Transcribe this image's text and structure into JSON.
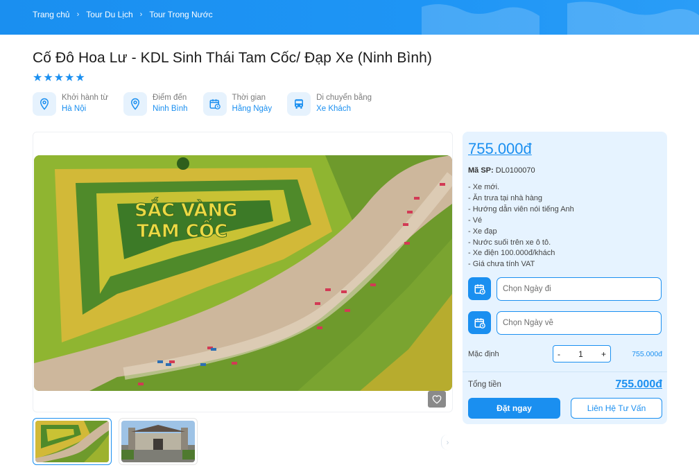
{
  "breadcrumb": {
    "items": [
      "Trang chủ",
      "Tour Du Lịch",
      "Tour Trong Nước"
    ]
  },
  "tour": {
    "title": "Cố Đô Hoa Lư - KDL Sinh Thái Tam Cốc/ Đạp Xe (Ninh Bình)",
    "rating_stars": 5
  },
  "info": [
    {
      "label": "Khởi hành từ",
      "value": "Hà Nội",
      "icon": "map-pin-icon"
    },
    {
      "label": "Điểm đến",
      "value": "Ninh Bình",
      "icon": "map-pin-icon"
    },
    {
      "label": "Thời gian",
      "value": "Hằng Ngày",
      "icon": "calendar-clock-icon"
    },
    {
      "label": "Di chuyển bằng",
      "value": "Xe Khách",
      "icon": "bus-icon"
    }
  ],
  "gallery": {
    "photo_text_line1": "SẮC VÀNG",
    "photo_text_line2": "TAM CỐC"
  },
  "booking": {
    "price": "755.000đ",
    "sku_label": "Mã SP:",
    "sku_value": "DL0100070",
    "features": [
      "- Xe mới.",
      "- Ăn trưa tại nhà hàng",
      "- Hướng dẫn viên nói tiếng Anh",
      "- Vé",
      "- Xe đạp",
      "- Nước suối trên xe ô tô.",
      "- Xe điện 100.000đ/khách",
      "- Giá chưa tính VAT"
    ],
    "depart_placeholder": "Chọn Ngày đi",
    "return_placeholder": "Chọn Ngày về",
    "qty_label": "Mặc định",
    "qty_minus": "-",
    "qty_value": "1",
    "qty_plus": "+",
    "qty_price": "755.000đ",
    "total_label": "Tổng tiền",
    "total_value": "755.000đ",
    "book_label": "Đặt ngay",
    "contact_label": "Liên Hệ Tư Vấn"
  },
  "colors": {
    "brand": "#1a8ff0",
    "panel_bg": "#e6f3ff"
  }
}
